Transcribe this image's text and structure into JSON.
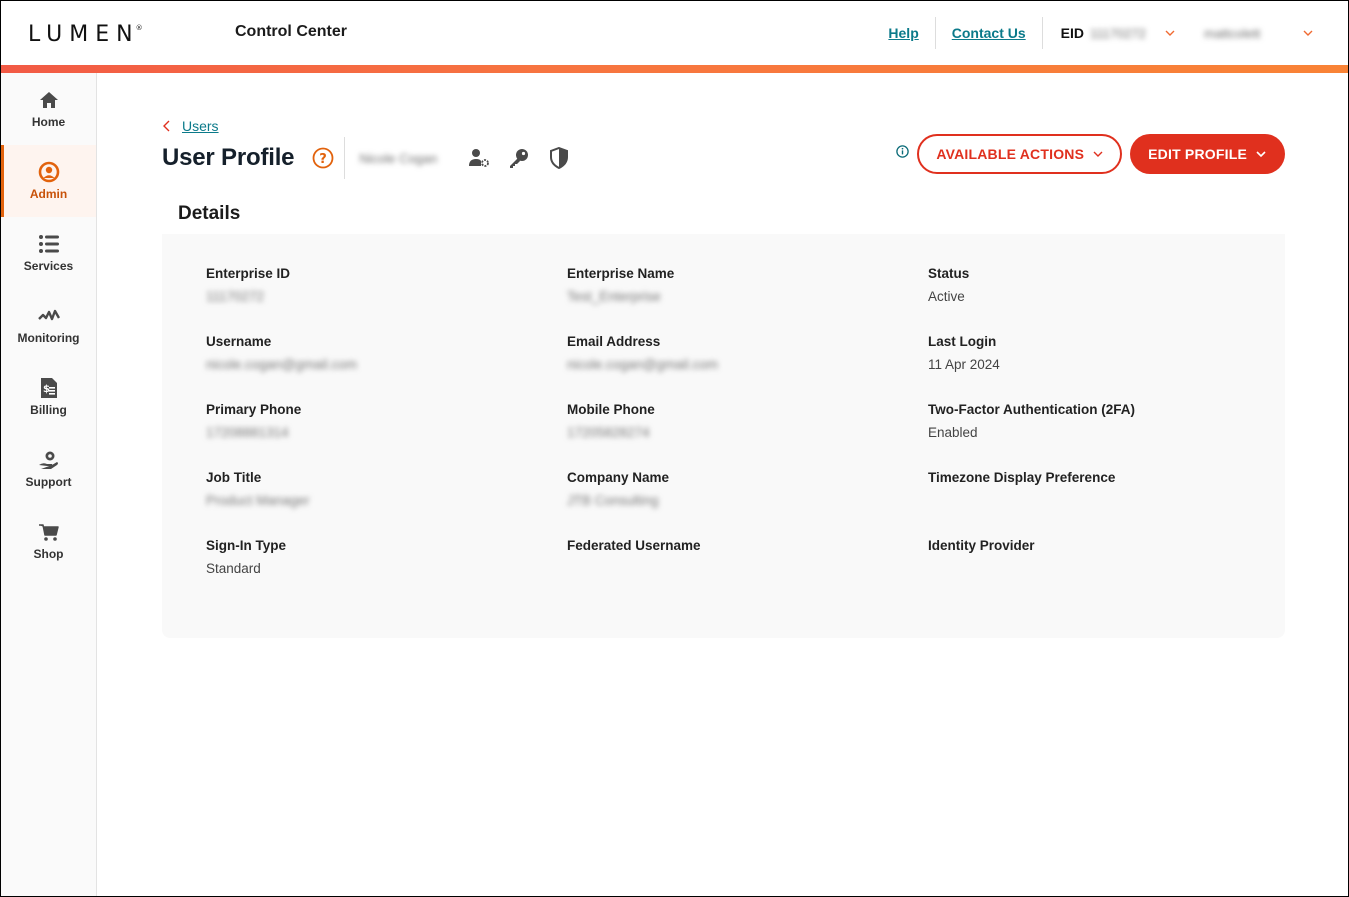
{
  "header": {
    "logo_text": "LUMEN",
    "logo_mark": "®",
    "app_title": "Control Center",
    "links": [
      {
        "label": "Help"
      },
      {
        "label": "Contact Us"
      }
    ],
    "eid_label": "EID",
    "eid_value": "11170272",
    "user_menu_value": "mattcolett",
    "accent_color": "#f77440"
  },
  "sidebar": {
    "items": [
      {
        "label": "Home",
        "icon": "home-icon",
        "active": false
      },
      {
        "label": "Admin",
        "icon": "user-circle-icon",
        "active": true
      },
      {
        "label": "Services",
        "icon": "list-icon",
        "active": false
      },
      {
        "label": "Monitoring",
        "icon": "pulse-icon",
        "active": false
      },
      {
        "label": "Billing",
        "icon": "invoice-icon",
        "active": false
      },
      {
        "label": "Support",
        "icon": "support-hand-icon",
        "active": false
      },
      {
        "label": "Shop",
        "icon": "cart-icon",
        "active": false
      }
    ],
    "active_color": "#e2620c"
  },
  "page": {
    "breadcrumb": "Users",
    "title": "User Profile",
    "user_name": "Nicole Cogan",
    "icons": [
      "user-settings-icon",
      "key-icon",
      "shield-icon"
    ],
    "actions": {
      "available_actions": "AVAILABLE ACTIONS",
      "edit_profile": "EDIT PROFILE"
    },
    "primary_color": "#e0301e",
    "section_title": "Details"
  },
  "details": {
    "fields": [
      {
        "label": "Enterprise ID",
        "value": "11170272",
        "redacted": true
      },
      {
        "label": "Enterprise Name",
        "value": "Test_Enterprise",
        "redacted": true
      },
      {
        "label": "Status",
        "value": "Active",
        "redacted": false
      },
      {
        "label": "Username",
        "value": "nicole.cogan@gmail.com",
        "redacted": true
      },
      {
        "label": "Email Address",
        "value": "nicole.cogan@gmail.com",
        "redacted": true
      },
      {
        "label": "Last Login",
        "value": "11 Apr 2024",
        "redacted": false
      },
      {
        "label": "Primary Phone",
        "value": "17208881314",
        "redacted": true
      },
      {
        "label": "Mobile Phone",
        "value": "17205828274",
        "redacted": true
      },
      {
        "label": "Two-Factor Authentication (2FA)",
        "value": "Enabled",
        "redacted": false
      },
      {
        "label": "Job Title",
        "value": "Product Manager",
        "redacted": true
      },
      {
        "label": "Company Name",
        "value": "JTB Consulting",
        "redacted": true
      },
      {
        "label": "Timezone Display Preference",
        "value": "",
        "redacted": false
      },
      {
        "label": "Sign-In Type",
        "value": "Standard",
        "redacted": false
      },
      {
        "label": "Federated Username",
        "value": "",
        "redacted": false
      },
      {
        "label": "Identity Provider",
        "value": "",
        "redacted": false
      }
    ]
  }
}
